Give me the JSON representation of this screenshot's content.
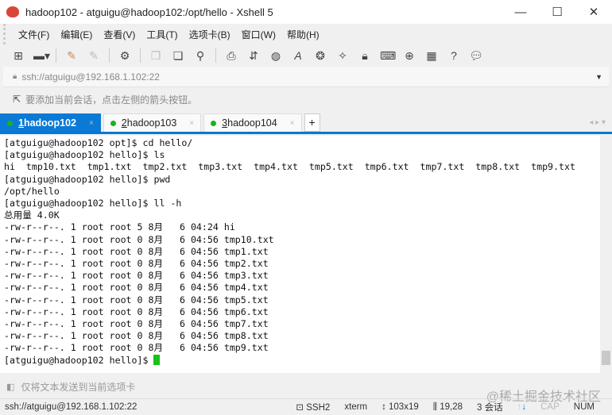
{
  "window": {
    "title": "hadoop102 - atguigu@hadoop102:/opt/hello - Xshell 5",
    "minimize": "—",
    "maximize": "☐",
    "close": "✕"
  },
  "menu": [
    "文件(F)",
    "编辑(E)",
    "查看(V)",
    "工具(T)",
    "选项卡(B)",
    "窗口(W)",
    "帮助(H)"
  ],
  "address": {
    "value": "ssh://atguigu@192.168.1.102:22"
  },
  "hint": "要添加当前会话，点击左侧的箭头按钮。",
  "tabs": [
    {
      "num": "1",
      "label": " hadoop102",
      "active": true
    },
    {
      "num": "2",
      "label": " hadoop103"
    },
    {
      "num": "3",
      "label": " hadoop104"
    }
  ],
  "tab_add": "+",
  "terminal": {
    "lines": [
      "[atguigu@hadoop102 opt]$ cd hello/",
      "[atguigu@hadoop102 hello]$ ls",
      "hi  tmp10.txt  tmp1.txt  tmp2.txt  tmp3.txt  tmp4.txt  tmp5.txt  tmp6.txt  tmp7.txt  tmp8.txt  tmp9.txt",
      "[atguigu@hadoop102 hello]$ pwd",
      "/opt/hello",
      "[atguigu@hadoop102 hello]$ ll -h",
      "总用量 4.0K",
      "-rw-r--r--. 1 root root 5 8月   6 04:24 hi",
      "-rw-r--r--. 1 root root 0 8月   6 04:56 tmp10.txt",
      "-rw-r--r--. 1 root root 0 8月   6 04:56 tmp1.txt",
      "-rw-r--r--. 1 root root 0 8月   6 04:56 tmp2.txt",
      "-rw-r--r--. 1 root root 0 8月   6 04:56 tmp3.txt",
      "-rw-r--r--. 1 root root 0 8月   6 04:56 tmp4.txt",
      "-rw-r--r--. 1 root root 0 8月   6 04:56 tmp5.txt",
      "-rw-r--r--. 1 root root 0 8月   6 04:56 tmp6.txt",
      "-rw-r--r--. 1 root root 0 8月   6 04:56 tmp7.txt",
      "-rw-r--r--. 1 root root 0 8月   6 04:56 tmp8.txt",
      "-rw-r--r--. 1 root root 0 8月   6 04:56 tmp9.txt"
    ],
    "prompt": "[atguigu@hadoop102 hello]$ "
  },
  "sendbar": "仅将文本发送到当前选项卡",
  "watermark": "@稀土掘金技术社区",
  "status": {
    "conn": "ssh://atguigu@192.168.1.102:22",
    "proto": "SSH2",
    "term": "xterm",
    "size": "103x19",
    "pos": "19,28",
    "sessions": "3 会话",
    "cap": "CAP",
    "num": "NUM"
  }
}
